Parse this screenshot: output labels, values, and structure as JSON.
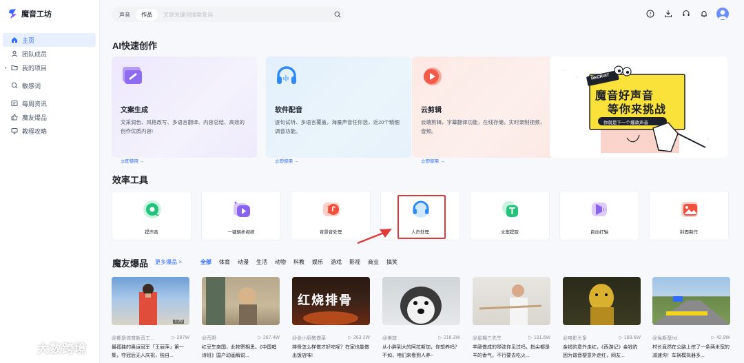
{
  "app": {
    "title": "魔音工坊"
  },
  "sidebar": {
    "items": [
      {
        "label": "主页",
        "icon": "home-icon"
      },
      {
        "label": "团队成员",
        "icon": "user-icon"
      },
      {
        "label": "我的项目",
        "icon": "folder-icon"
      },
      {
        "label": "敏感词",
        "icon": "search-doc-icon"
      },
      {
        "label": "每周资讯",
        "icon": "news-icon"
      },
      {
        "label": "魔友爆品",
        "icon": "thumbs-up-icon"
      },
      {
        "label": "教程攻略",
        "icon": "monitor-icon"
      }
    ]
  },
  "search": {
    "tabs": [
      "声音",
      "作品"
    ],
    "active_tab": "作品",
    "placeholder": "文章关键词搜索查询"
  },
  "ai_section": {
    "title": "AI快速创作",
    "cards": [
      {
        "title": "文案生成",
        "desc": "文采润色、风格改写、多语言翻译、内容总结、高效的创作优质内容!",
        "link": "立即使用 →",
        "icon": "doc-write-icon"
      },
      {
        "title": "软件配音",
        "desc": "逐句试听、多语言覆盖，海量声音任你选，近20个精细调音功能。",
        "link": "立即使用 →",
        "icon": "headphone-icon"
      },
      {
        "title": "云剪辑",
        "desc": "云端剪辑，字幕翻译功能，在线存储，实时录制视频，音频。",
        "link": "立即使用 →",
        "icon": "video-clip-icon"
      }
    ],
    "banner": {
      "tag": "RECRUIT",
      "line1": "魔音好声音",
      "line2": "等你来挑战",
      "sub": "你就是下一个爆款声音"
    }
  },
  "tools_section": {
    "title": "效率工具",
    "tools": [
      {
        "label": "提声音",
        "icon": "extract-audio-icon"
      },
      {
        "label": "一键解析视频",
        "icon": "parse-video-icon"
      },
      {
        "label": "背景音处理",
        "icon": "bg-music-icon"
      },
      {
        "label": "人声处理",
        "icon": "vocal-process-icon"
      },
      {
        "label": "文案提取",
        "icon": "text-extract-icon"
      },
      {
        "label": "自动打轴",
        "icon": "auto-timeline-icon"
      },
      {
        "label": "封面制作",
        "icon": "cover-make-icon"
      }
    ]
  },
  "hot_section": {
    "title": "魔友爆品",
    "more": "更多爆品 >",
    "categories": [
      "全部",
      "体育",
      "动漫",
      "生活",
      "动物",
      "科教",
      "娱乐",
      "游戏",
      "影视",
      "商业",
      "搞笑"
    ],
    "active_category": "全部",
    "videos": [
      {
        "author": "@都是体育新音工...",
        "views": "287W",
        "title": "最孤独的奥运冠军「王丽萍」第一集，夺冠后无人庆祝，独自...",
        "duration": "1:29"
      },
      {
        "author": "@荒野",
        "views": "267.4W",
        "title": "红豆生南国，此物寄相思。《中国唱诗班》国产动画解说..."
      },
      {
        "author": "@张小厨教做菜",
        "views": "263.1W",
        "title": "排骨怎么样做才好吃呢？在家也能做出饭店味!",
        "thumb_text": "红烧排骨"
      },
      {
        "author": "@美故",
        "views": "216.3W",
        "title": "从小胖到大的阿拉斯加，你想养吗？不如，咱们来看到人养~"
      },
      {
        "author": "@星期三先生",
        "views": "191.6W",
        "title": "羊肠做成的琴弦你见过吗，指尖都是羊的香气，不行要去吃火..."
      },
      {
        "author": "@电影头条",
        "views": "189.6W",
        "title": "金钱豹意外走红，《西游记》金钱豹因为谐音梗意外走红，网友..."
      },
      {
        "author": "@兔斯基hd",
        "views": "42.9W",
        "title": "村长竟然在公路上挖了一条两米宽的减速沟！车祸模拟器多..."
      }
    ]
  },
  "watermark": {
    "text": "大数跨境"
  },
  "colors": {
    "accent": "#2f6bff",
    "highlight": "#e03a3a"
  }
}
